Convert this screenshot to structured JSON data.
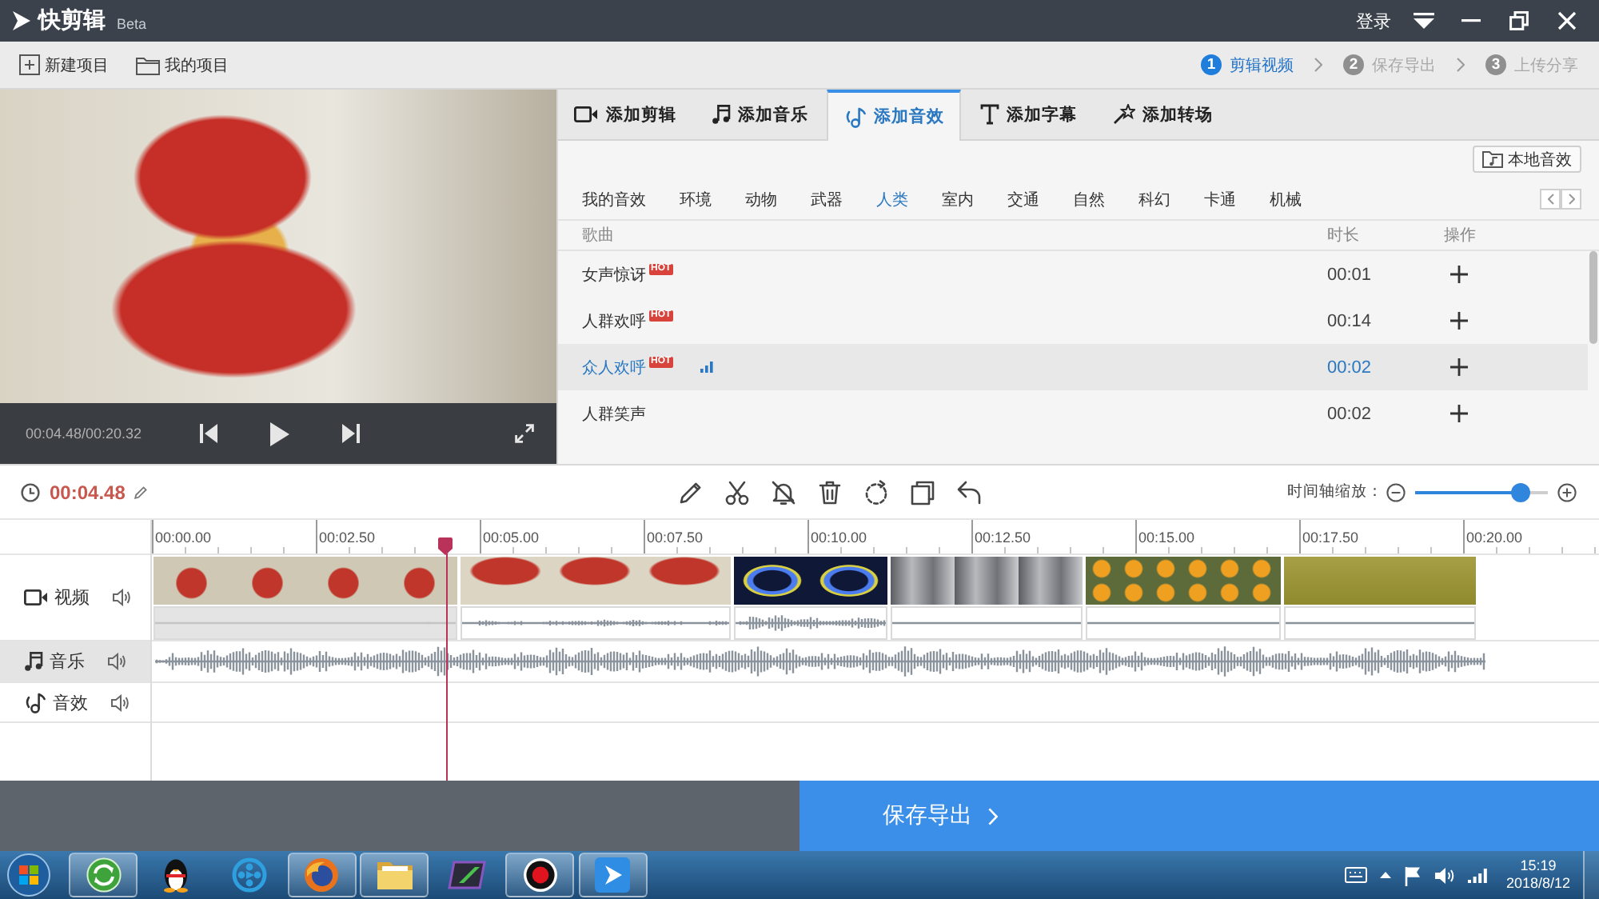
{
  "window": {
    "app_name": "快剪辑",
    "badge": "Beta",
    "login": "登录"
  },
  "toolbar": {
    "buttons": [
      {
        "kind": "new",
        "label": "新建项目"
      },
      {
        "kind": "open",
        "label": "我的项目"
      }
    ],
    "steps": [
      {
        "number": "1",
        "label": "剪辑视频",
        "selected": true
      },
      {
        "number": "2",
        "label": "保存导出",
        "selected": false
      },
      {
        "number": "3",
        "label": "上传分享",
        "selected": false
      }
    ]
  },
  "preview": {
    "timecode": "00:04.48/00:20.32"
  },
  "panel": {
    "tabs": [
      {
        "kind": "clip",
        "label": "添加剪辑",
        "selected": false
      },
      {
        "kind": "music",
        "label": "添加音乐",
        "selected": false
      },
      {
        "kind": "effect",
        "label": "添加音效",
        "selected": true
      },
      {
        "kind": "subtitle",
        "label": "添加字幕",
        "selected": false
      },
      {
        "kind": "transition",
        "label": "添加转场",
        "selected": false
      }
    ],
    "local_button": "本地音效",
    "categories": [
      {
        "label": "我的音效",
        "selected": false
      },
      {
        "label": "环境",
        "selected": false
      },
      {
        "label": "动物",
        "selected": false
      },
      {
        "label": "武器",
        "selected": false
      },
      {
        "label": "人类",
        "selected": true
      },
      {
        "label": "室内",
        "selected": false
      },
      {
        "label": "交通",
        "selected": false
      },
      {
        "label": "自然",
        "selected": false
      },
      {
        "label": "科幻",
        "selected": false
      },
      {
        "label": "卡通",
        "selected": false
      },
      {
        "label": "机械",
        "selected": false
      }
    ],
    "columns": [
      "歌曲",
      "时长",
      "操作"
    ],
    "rows": [
      {
        "name": "女声惊讶",
        "badge": "HOT",
        "playing": false,
        "duration": "00:01",
        "selected": false
      },
      {
        "name": "人群欢呼",
        "badge": "HOT",
        "playing": false,
        "duration": "00:14",
        "selected": false
      },
      {
        "name": "众人欢呼",
        "badge": "HOT",
        "playing": true,
        "duration": "00:02",
        "selected": true
      },
      {
        "name": "人群笑声",
        "playing": false,
        "duration": "00:02",
        "selected": false
      }
    ]
  },
  "timeline": {
    "time": "00:04.48",
    "zoom_label": "时间轴缩放：",
    "zoom": {
      "level": 0.8
    },
    "ruler": [
      "00:00.00",
      "00:02.50",
      "00:05.00",
      "00:07.50",
      "00:10.00",
      "00:12.50",
      "00:15.00",
      "00:17.50",
      "00:20.00"
    ],
    "playhead": {
      "level": 0.203
    },
    "tracks": [
      {
        "kind": "video",
        "label": "视频",
        "selected": false
      },
      {
        "kind": "music",
        "label": "音乐",
        "selected": true
      },
      {
        "kind": "effect",
        "label": "音效",
        "selected": false
      }
    ]
  },
  "export": {
    "label": "保存导出"
  },
  "taskbar": {
    "apps": [
      {
        "kind": "refresh",
        "running": true
      },
      {
        "kind": "penguin",
        "running": false
      },
      {
        "kind": "reel",
        "running": false
      },
      {
        "kind": "globe",
        "running": true
      },
      {
        "kind": "folder",
        "running": true
      },
      {
        "kind": "screen",
        "running": false
      },
      {
        "kind": "record",
        "running": true
      },
      {
        "kind": "playtile",
        "running": true
      }
    ],
    "time": "15:19",
    "date": "2018/8/12"
  }
}
